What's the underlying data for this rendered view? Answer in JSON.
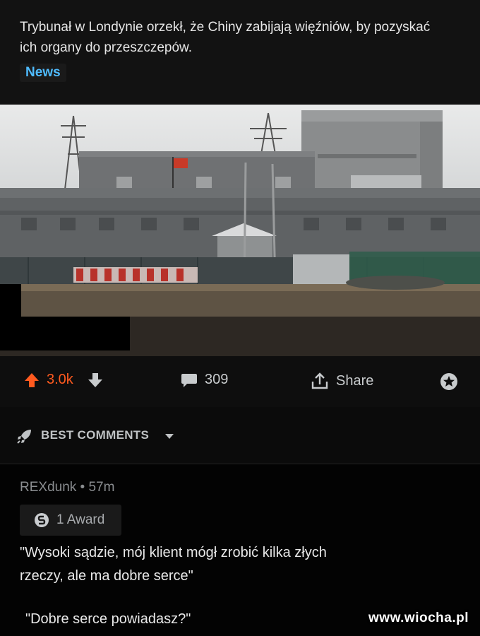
{
  "post": {
    "title": "Trybunał w Londynie orzekł, że Chiny zabijają więźniów, by pozyskać ich organy do przeszczepów.",
    "flair": "News"
  },
  "actions": {
    "upvotes": "3.0k",
    "comments": "309",
    "share": "Share"
  },
  "sort": {
    "label": "BEST COMMENTS"
  },
  "comment": {
    "meta": "REXdunk • 57m",
    "award": "1 Award",
    "line1": "\"Wysoki sądzie, mój klient mógł zrobić kilka złych",
    "line2": "rzeczy, ale ma dobre serce\"",
    "line3": "\"Dobre serce powiadasz?\""
  },
  "watermark": "www.wiocha.pl",
  "colors": {
    "upvote": "#ff5a1f",
    "flair": "#4fbcff",
    "background": "#000000"
  },
  "icons": [
    "upvote-arrow-icon",
    "downvote-arrow-icon",
    "comment-bubble-icon",
    "share-icon",
    "award-icon",
    "rocket-icon",
    "chevron-down-icon"
  ]
}
